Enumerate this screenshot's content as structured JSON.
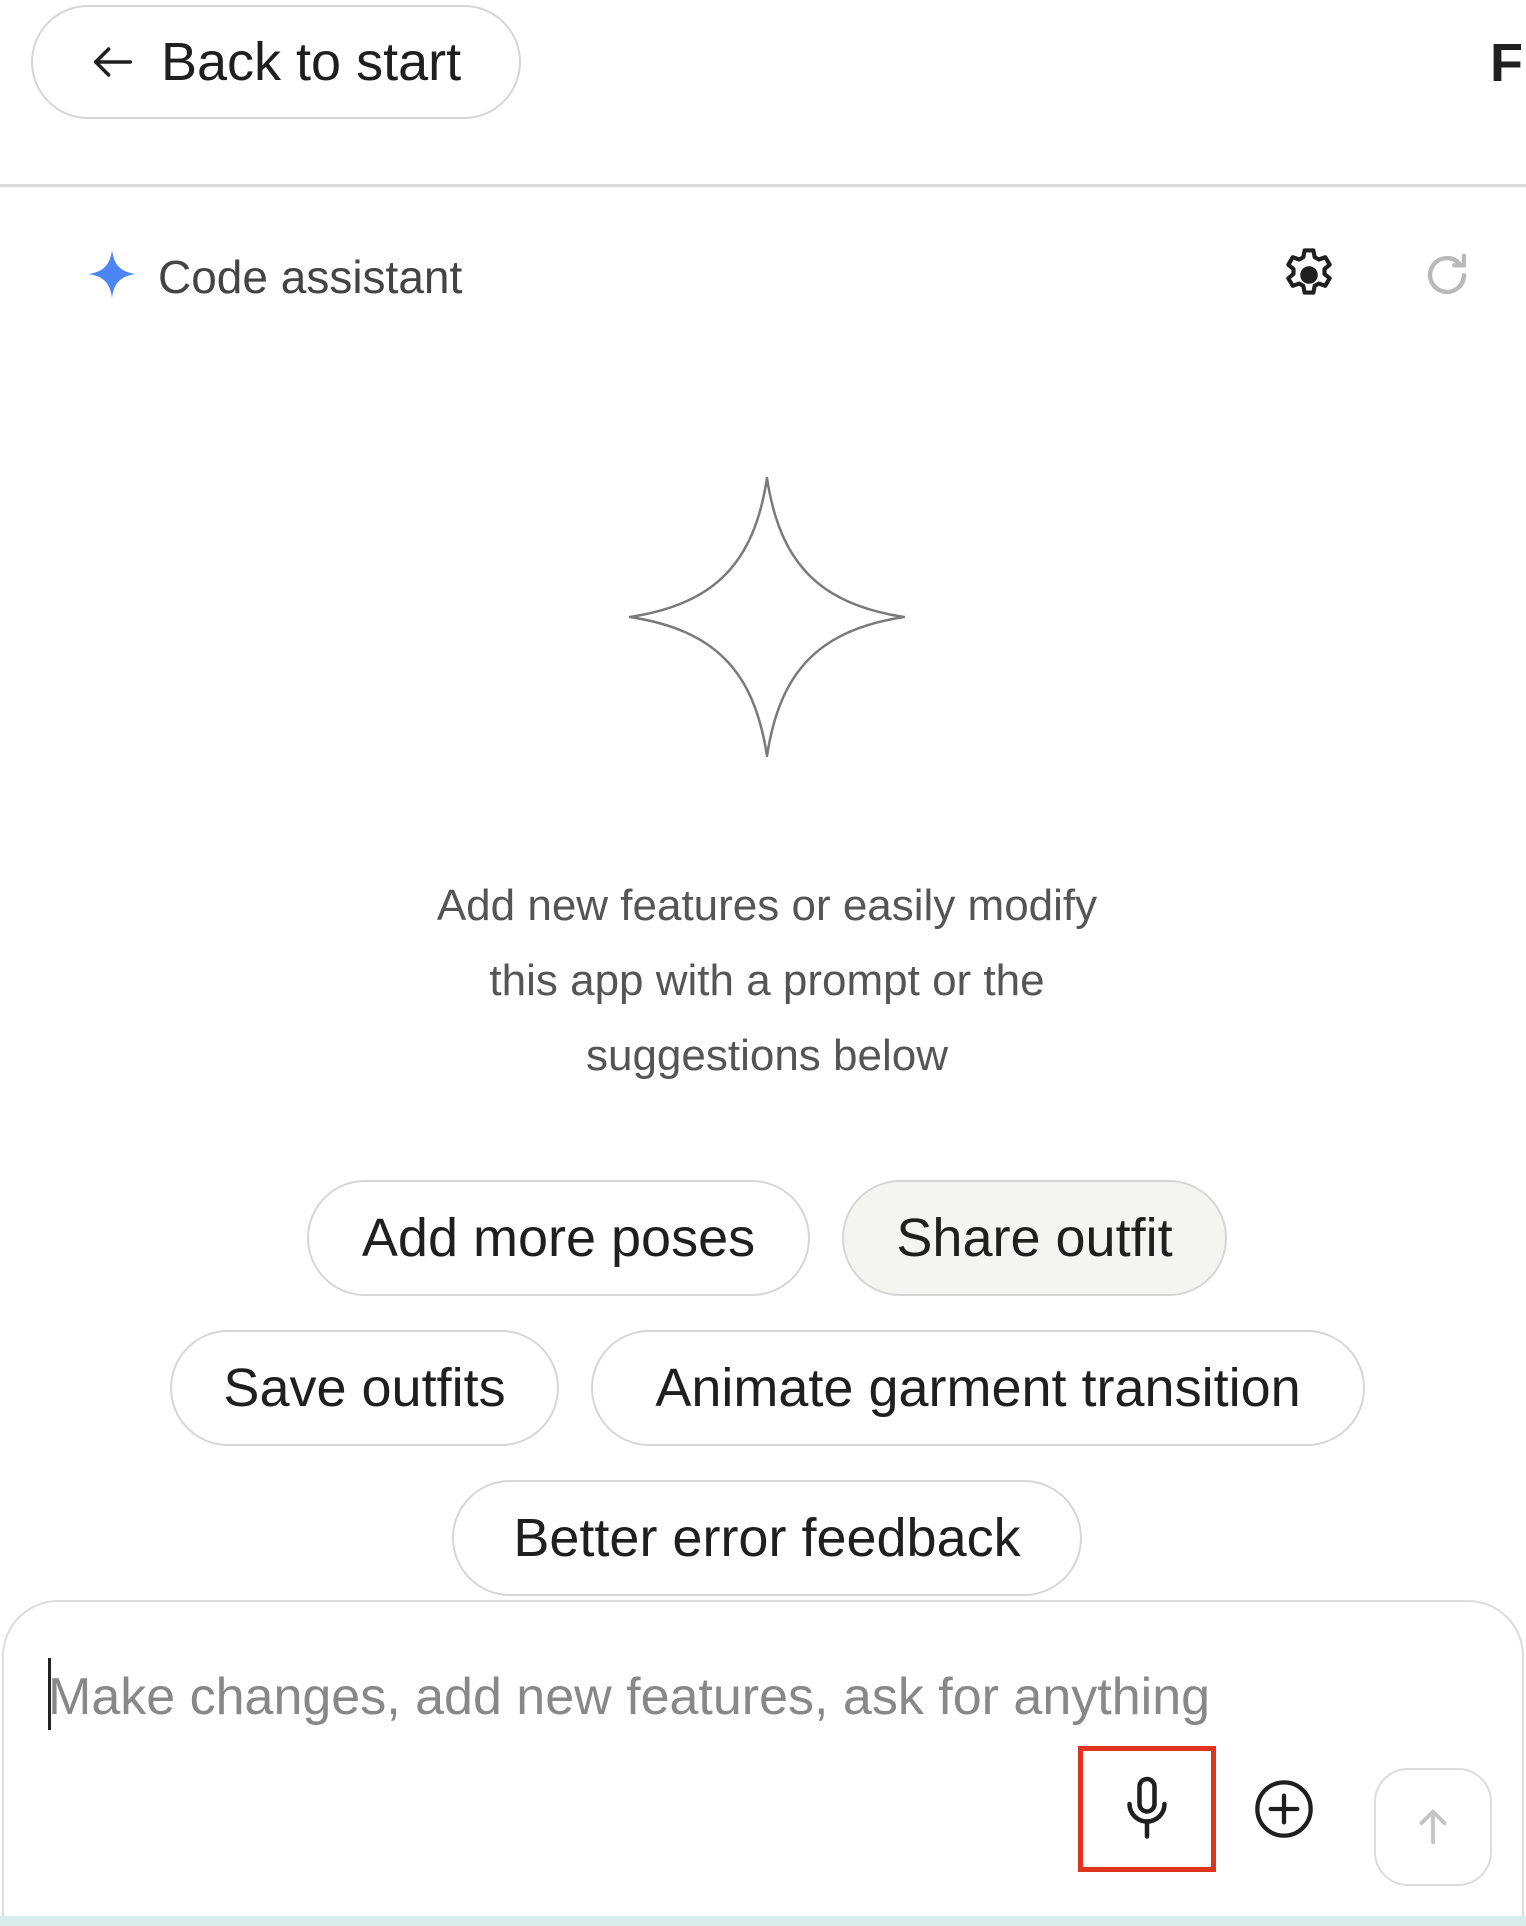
{
  "topbar": {
    "back_label": "Back to start",
    "cut_letter": "F"
  },
  "panel": {
    "title": "Code assistant",
    "settings_icon": "gear-icon",
    "refresh_icon": "refresh-icon"
  },
  "intro": {
    "line1": "Add new features or easily modify",
    "line2": "this app with a prompt or the",
    "line3": "suggestions below"
  },
  "suggestions": [
    "Add more poses",
    "Share outfit",
    "Save outfits",
    "Animate garment transition",
    "Better error feedback"
  ],
  "composer": {
    "placeholder": "Make changes, add new features, ask for anything",
    "value": ""
  },
  "colors": {
    "accent_blue": "#4c86f5",
    "highlight_red": "#e0341e"
  }
}
